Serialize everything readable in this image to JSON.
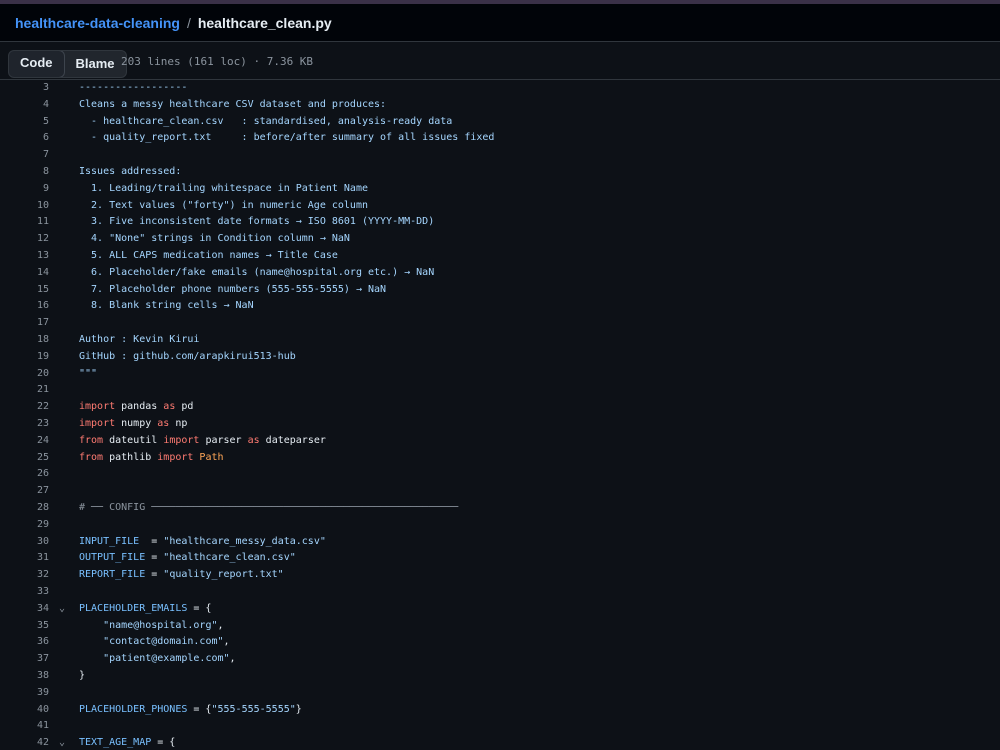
{
  "breadcrumb": {
    "repo": "healthcare-data-cleaning",
    "separator": "/",
    "file": "healthcare_clean.py"
  },
  "toolbar": {
    "code_label": "Code",
    "blame_label": "Blame",
    "file_meta": "203 lines (161 loc) · 7.36 KB"
  },
  "colors": {
    "background": "#0d1117",
    "link": "#4493f8",
    "docstring": "#a5d6ff",
    "keyword": "#ff7b72",
    "constant": "#79c0ff",
    "line_number": "#8b949e"
  },
  "code": {
    "lines": [
      {
        "n": "3",
        "fold": "",
        "segs": [
          {
            "t": "------------------",
            "c": "s"
          }
        ]
      },
      {
        "n": "4",
        "fold": "",
        "segs": [
          {
            "t": "Cleans a messy healthcare CSV dataset and produces:",
            "c": "s"
          }
        ]
      },
      {
        "n": "5",
        "fold": "",
        "segs": [
          {
            "t": "  - healthcare_clean.csv   : standardised, analysis-ready data",
            "c": "s"
          }
        ]
      },
      {
        "n": "6",
        "fold": "",
        "segs": [
          {
            "t": "  - quality_report.txt     : before/after summary of all issues fixed",
            "c": "s"
          }
        ]
      },
      {
        "n": "7",
        "fold": "",
        "segs": []
      },
      {
        "n": "8",
        "fold": "",
        "segs": [
          {
            "t": "Issues addressed:",
            "c": "s"
          }
        ]
      },
      {
        "n": "9",
        "fold": "",
        "segs": [
          {
            "t": "  1. Leading/trailing whitespace in Patient Name",
            "c": "s"
          }
        ]
      },
      {
        "n": "10",
        "fold": "",
        "segs": [
          {
            "t": "  2. Text values (\"forty\") in numeric Age column",
            "c": "s"
          }
        ]
      },
      {
        "n": "11",
        "fold": "",
        "segs": [
          {
            "t": "  3. Five inconsistent date formats → ISO 8601 (YYYY-MM-DD)",
            "c": "s"
          }
        ]
      },
      {
        "n": "12",
        "fold": "",
        "segs": [
          {
            "t": "  4. \"None\" strings in Condition column → NaN",
            "c": "s"
          }
        ]
      },
      {
        "n": "13",
        "fold": "",
        "segs": [
          {
            "t": "  5. ALL CAPS medication names → Title Case",
            "c": "s"
          }
        ]
      },
      {
        "n": "14",
        "fold": "",
        "segs": [
          {
            "t": "  6. Placeholder/fake emails (name@hospital.org etc.) → NaN",
            "c": "s"
          }
        ]
      },
      {
        "n": "15",
        "fold": "",
        "segs": [
          {
            "t": "  7. Placeholder phone numbers (555-555-5555) → NaN",
            "c": "s"
          }
        ]
      },
      {
        "n": "16",
        "fold": "",
        "segs": [
          {
            "t": "  8. Blank string cells → NaN",
            "c": "s"
          }
        ]
      },
      {
        "n": "17",
        "fold": "",
        "segs": []
      },
      {
        "n": "18",
        "fold": "",
        "segs": [
          {
            "t": "Author : Kevin Kirui",
            "c": "s"
          }
        ]
      },
      {
        "n": "19",
        "fold": "",
        "segs": [
          {
            "t": "GitHub : github.com/arapkirui513-hub",
            "c": "s"
          }
        ]
      },
      {
        "n": "20",
        "fold": "",
        "segs": [
          {
            "t": "\"\"\"",
            "c": "s"
          }
        ]
      },
      {
        "n": "21",
        "fold": "",
        "segs": []
      },
      {
        "n": "22",
        "fold": "",
        "segs": [
          {
            "t": "import",
            "c": "k"
          },
          {
            "t": " pandas ",
            "c": "p"
          },
          {
            "t": "as",
            "c": "k"
          },
          {
            "t": " pd",
            "c": "p"
          }
        ]
      },
      {
        "n": "23",
        "fold": "",
        "segs": [
          {
            "t": "import",
            "c": "k"
          },
          {
            "t": " numpy ",
            "c": "p"
          },
          {
            "t": "as",
            "c": "k"
          },
          {
            "t": " np",
            "c": "p"
          }
        ]
      },
      {
        "n": "24",
        "fold": "",
        "segs": [
          {
            "t": "from",
            "c": "k"
          },
          {
            "t": " dateutil ",
            "c": "p"
          },
          {
            "t": "import",
            "c": "k"
          },
          {
            "t": " parser ",
            "c": "p"
          },
          {
            "t": "as",
            "c": "k"
          },
          {
            "t": " dateparser",
            "c": "p"
          }
        ]
      },
      {
        "n": "25",
        "fold": "",
        "segs": [
          {
            "t": "from",
            "c": "k"
          },
          {
            "t": " pathlib ",
            "c": "p"
          },
          {
            "t": "import",
            "c": "k"
          },
          {
            "t": " Path",
            "c": "o"
          }
        ]
      },
      {
        "n": "26",
        "fold": "",
        "segs": []
      },
      {
        "n": "27",
        "fold": "",
        "segs": []
      },
      {
        "n": "28",
        "fold": "",
        "segs": [
          {
            "t": "# ── CONFIG ───────────────────────────────────────────────────",
            "c": "c"
          }
        ]
      },
      {
        "n": "29",
        "fold": "",
        "segs": []
      },
      {
        "n": "30",
        "fold": "",
        "segs": [
          {
            "t": "INPUT_FILE",
            "c": "v"
          },
          {
            "t": "  = ",
            "c": "p"
          },
          {
            "t": "\"healthcare_messy_data.csv\"",
            "c": "s"
          }
        ]
      },
      {
        "n": "31",
        "fold": "",
        "segs": [
          {
            "t": "OUTPUT_FILE",
            "c": "v"
          },
          {
            "t": " = ",
            "c": "p"
          },
          {
            "t": "\"healthcare_clean.csv\"",
            "c": "s"
          }
        ]
      },
      {
        "n": "32",
        "fold": "",
        "segs": [
          {
            "t": "REPORT_FILE",
            "c": "v"
          },
          {
            "t": " = ",
            "c": "p"
          },
          {
            "t": "\"quality_report.txt\"",
            "c": "s"
          }
        ]
      },
      {
        "n": "33",
        "fold": "",
        "segs": []
      },
      {
        "n": "34",
        "fold": "⌄",
        "segs": [
          {
            "t": "PLACEHOLDER_EMAILS",
            "c": "v"
          },
          {
            "t": " = {",
            "c": "p"
          }
        ]
      },
      {
        "n": "35",
        "fold": "",
        "segs": [
          {
            "t": "    ",
            "c": "p"
          },
          {
            "t": "\"name@hospital.org\"",
            "c": "s"
          },
          {
            "t": ",",
            "c": "p"
          }
        ]
      },
      {
        "n": "36",
        "fold": "",
        "segs": [
          {
            "t": "    ",
            "c": "p"
          },
          {
            "t": "\"contact@domain.com\"",
            "c": "s"
          },
          {
            "t": ",",
            "c": "p"
          }
        ]
      },
      {
        "n": "37",
        "fold": "",
        "segs": [
          {
            "t": "    ",
            "c": "p"
          },
          {
            "t": "\"patient@example.com\"",
            "c": "s"
          },
          {
            "t": ",",
            "c": "p"
          }
        ]
      },
      {
        "n": "38",
        "fold": "",
        "segs": [
          {
            "t": "}",
            "c": "p"
          }
        ]
      },
      {
        "n": "39",
        "fold": "",
        "segs": []
      },
      {
        "n": "40",
        "fold": "",
        "segs": [
          {
            "t": "PLACEHOLDER_PHONES",
            "c": "v"
          },
          {
            "t": " = {",
            "c": "p"
          },
          {
            "t": "\"555-555-5555\"",
            "c": "s"
          },
          {
            "t": "}",
            "c": "p"
          }
        ]
      },
      {
        "n": "41",
        "fold": "",
        "segs": []
      },
      {
        "n": "42",
        "fold": "⌄",
        "segs": [
          {
            "t": "TEXT_AGE_MAP",
            "c": "v"
          },
          {
            "t": " = {",
            "c": "p"
          }
        ]
      }
    ]
  }
}
